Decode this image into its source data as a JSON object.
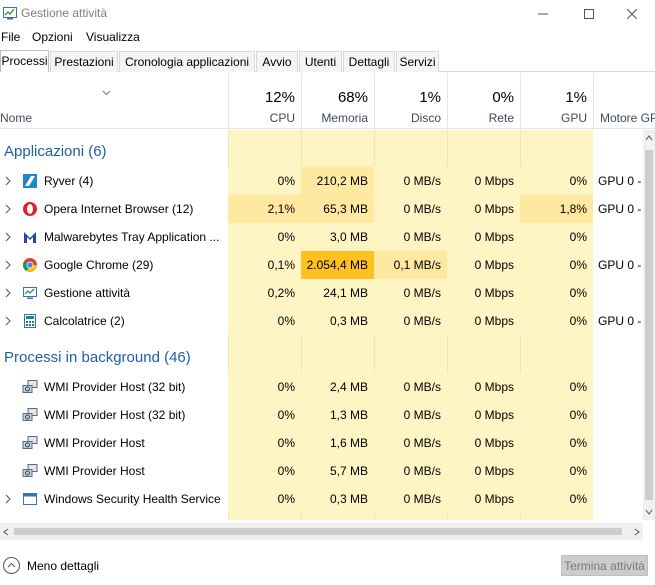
{
  "window": {
    "title": "Gestione attività"
  },
  "menu": [
    "File",
    "Opzioni",
    "Visualizza"
  ],
  "tabs": [
    "Processi",
    "Prestazioni",
    "Cronologia applicazioni",
    "Avvio",
    "Utenti",
    "Dettagli",
    "Servizi"
  ],
  "columns": {
    "name": "Nome",
    "cpu": {
      "pct": "12%",
      "label": "CPU"
    },
    "mem": {
      "pct": "68%",
      "label": "Memoria"
    },
    "disk": {
      "pct": "1%",
      "label": "Disco"
    },
    "net": {
      "pct": "0%",
      "label": "Rete"
    },
    "gpu": {
      "pct": "1%",
      "label": "GPU"
    },
    "engine": {
      "label": "Motore GPU"
    }
  },
  "sections": {
    "apps": "Applicazioni (6)",
    "background": "Processi in background (46)"
  },
  "apps": [
    {
      "name": "Ryver (4)",
      "cpu": "0%",
      "mem": "210,2 MB",
      "disk": "0 MB/s",
      "net": "0 Mbps",
      "gpu": "0%",
      "engine": "GPU 0 -",
      "icon": "ryver-icon"
    },
    {
      "name": "Opera Internet Browser (12)",
      "cpu": "2,1%",
      "mem": "65,3 MB",
      "disk": "0 MB/s",
      "net": "0 Mbps",
      "gpu": "1,8%",
      "engine": "GPU 0 -",
      "icon": "opera-icon"
    },
    {
      "name": "Malwarebytes Tray Application ...",
      "cpu": "0%",
      "mem": "3,0 MB",
      "disk": "0 MB/s",
      "net": "0 Mbps",
      "gpu": "0%",
      "engine": "",
      "icon": "malwarebytes-icon"
    },
    {
      "name": "Google Chrome (29)",
      "cpu": "0,1%",
      "mem": "2.054,4 MB",
      "disk": "0,1 MB/s",
      "net": "0 Mbps",
      "gpu": "0%",
      "engine": "GPU 0 -",
      "icon": "chrome-icon"
    },
    {
      "name": "Gestione attività",
      "cpu": "0,2%",
      "mem": "24,1 MB",
      "disk": "0 MB/s",
      "net": "0 Mbps",
      "gpu": "0%",
      "engine": "",
      "icon": "task-manager-icon"
    },
    {
      "name": "Calcolatrice (2)",
      "cpu": "0%",
      "mem": "0,3 MB",
      "disk": "0 MB/s",
      "net": "0 Mbps",
      "gpu": "0%",
      "engine": "GPU 0 -",
      "icon": "calculator-icon"
    }
  ],
  "background": [
    {
      "name": "WMI Provider Host (32 bit)",
      "cpu": "0%",
      "mem": "2,4 MB",
      "disk": "0 MB/s",
      "net": "0 Mbps",
      "gpu": "0%",
      "engine": "",
      "icon": "service-icon"
    },
    {
      "name": "WMI Provider Host (32 bit)",
      "cpu": "0%",
      "mem": "1,3 MB",
      "disk": "0 MB/s",
      "net": "0 Mbps",
      "gpu": "0%",
      "engine": "",
      "icon": "service-icon"
    },
    {
      "name": "WMI Provider Host",
      "cpu": "0%",
      "mem": "1,6 MB",
      "disk": "0 MB/s",
      "net": "0 Mbps",
      "gpu": "0%",
      "engine": "",
      "icon": "service-icon"
    },
    {
      "name": "WMI Provider Host",
      "cpu": "0%",
      "mem": "5,7 MB",
      "disk": "0 MB/s",
      "net": "0 Mbps",
      "gpu": "0%",
      "engine": "",
      "icon": "service-icon"
    },
    {
      "name": "Windows Security Health Service",
      "cpu": "0%",
      "mem": "0,3 MB",
      "disk": "0 MB/s",
      "net": "0 Mbps",
      "gpu": "0%",
      "engine": "",
      "icon": "window-app-icon"
    }
  ],
  "footer": {
    "less_details": "Meno dettagli",
    "end_task": "Termina attività"
  },
  "colors": {
    "heat_low": "#fff4c4",
    "heat_mid": "#ffe8a0",
    "heat_high": "#ffd65a",
    "heat_max": "#ffc11f",
    "section": "#1f5fa8"
  }
}
